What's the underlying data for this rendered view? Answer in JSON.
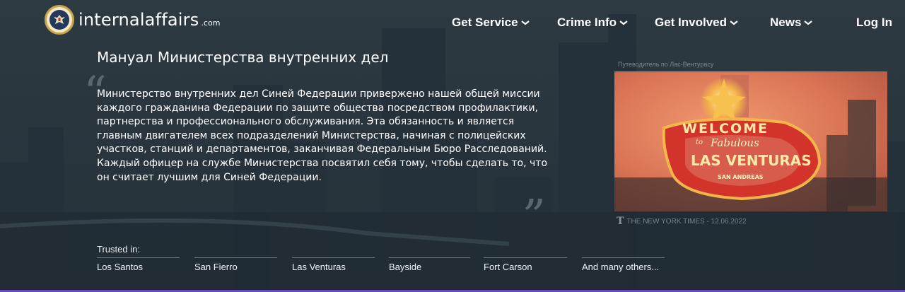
{
  "header": {
    "logo_text": "internalaffairs",
    "logo_suffix": ".com",
    "nav": {
      "get_service": "Get Service",
      "crime_info": "Crime Info",
      "get_involved": "Get Involved",
      "news": "News",
      "login": "Log In"
    }
  },
  "main": {
    "title": "Мануал Министерства внутренних дел",
    "quote_open": "“",
    "quote_close": "„",
    "mission": "Министерство внутренних дел Синей Федерации привержено нашей общей миссии каждого гражданина Федерации по защите общества посредством профилактики, партнерства и профессионального обслуживания. Эта обязанность и является главным двигателем всех подразделений Министерства, начиная с полицейских участков, станций и департаментов, заканчивая Федеральным Бюро Расследований. Каждый офицер на службе Министерства посвятил себя тому, чтобы сделать то, что он считает лучшим для Синей Федерации."
  },
  "trusted": {
    "label": "Trusted in:",
    "cities": [
      "Los Santos",
      "San Fierro",
      "Las Venturas",
      "Bayside",
      "Fort Carson",
      "And many others..."
    ]
  },
  "side": {
    "caption": "Путеводитель по Лас-Вентурасу",
    "sign": {
      "welcome": "WELCOME",
      "to": "to",
      "fabulous": "Fabulous",
      "city": "LAS VENTURAS",
      "state": "SAN ANDREAS"
    },
    "source_logo": "T",
    "source_text": "THE NEW YORK TIMES - 12.06.2022"
  },
  "colors": {
    "background": "#2a363e",
    "accent_bar": "#6a4bb0",
    "sign_glow": "#e87a55",
    "sign_red": "#d2332a"
  }
}
